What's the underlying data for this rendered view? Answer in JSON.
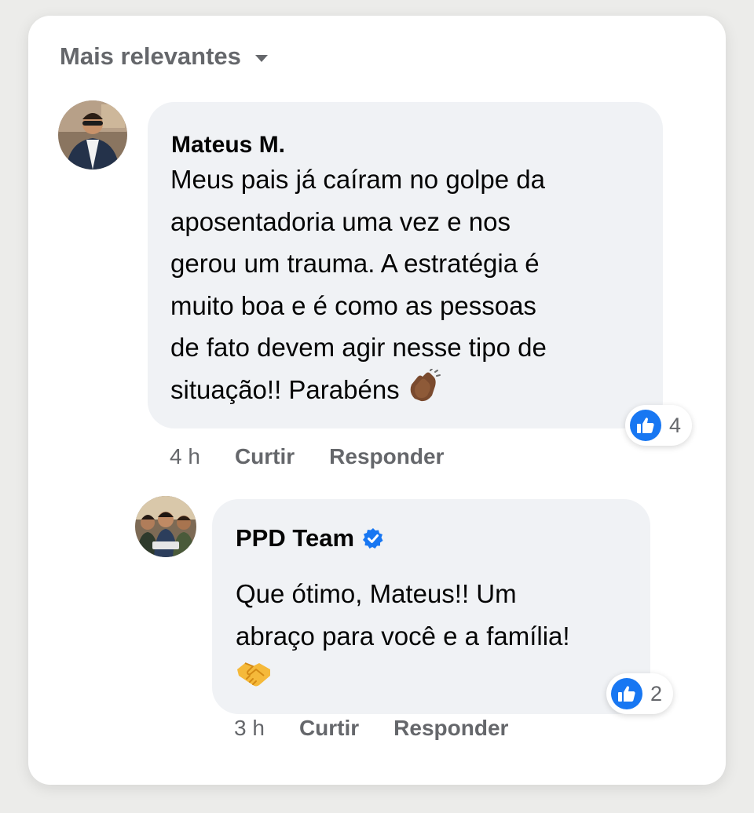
{
  "sort": {
    "label": "Mais relevantes"
  },
  "comments": [
    {
      "author": "Mateus M.",
      "lines": [
        "Meus pais já caíram no golpe da",
        "aposentadoria uma vez e nos",
        "gerou um trauma. A estratégia é",
        "muito boa e é como as pessoas",
        "de fato devem agir nesse tipo de",
        "situação!! Parabéns"
      ],
      "emoji": "clapping-hands-medium-dark",
      "reaction_icon": "like-icon",
      "reaction_count": "4",
      "time": "4 h",
      "like_label": "Curtir",
      "reply_label": "Responder"
    },
    {
      "author": "PPD Team",
      "verified": true,
      "lines": [
        "Que ótimo, Mateus!! Um",
        "abraço para você e a família!"
      ],
      "emoji": "handshake",
      "reaction_icon": "like-icon",
      "reaction_count": "2",
      "time": "3 h",
      "like_label": "Curtir",
      "reply_label": "Responder"
    }
  ],
  "colors": {
    "accent": "#1877f2",
    "bubble": "#f0f2f5",
    "secondary_text": "#65676b",
    "primary_text": "#050505"
  }
}
